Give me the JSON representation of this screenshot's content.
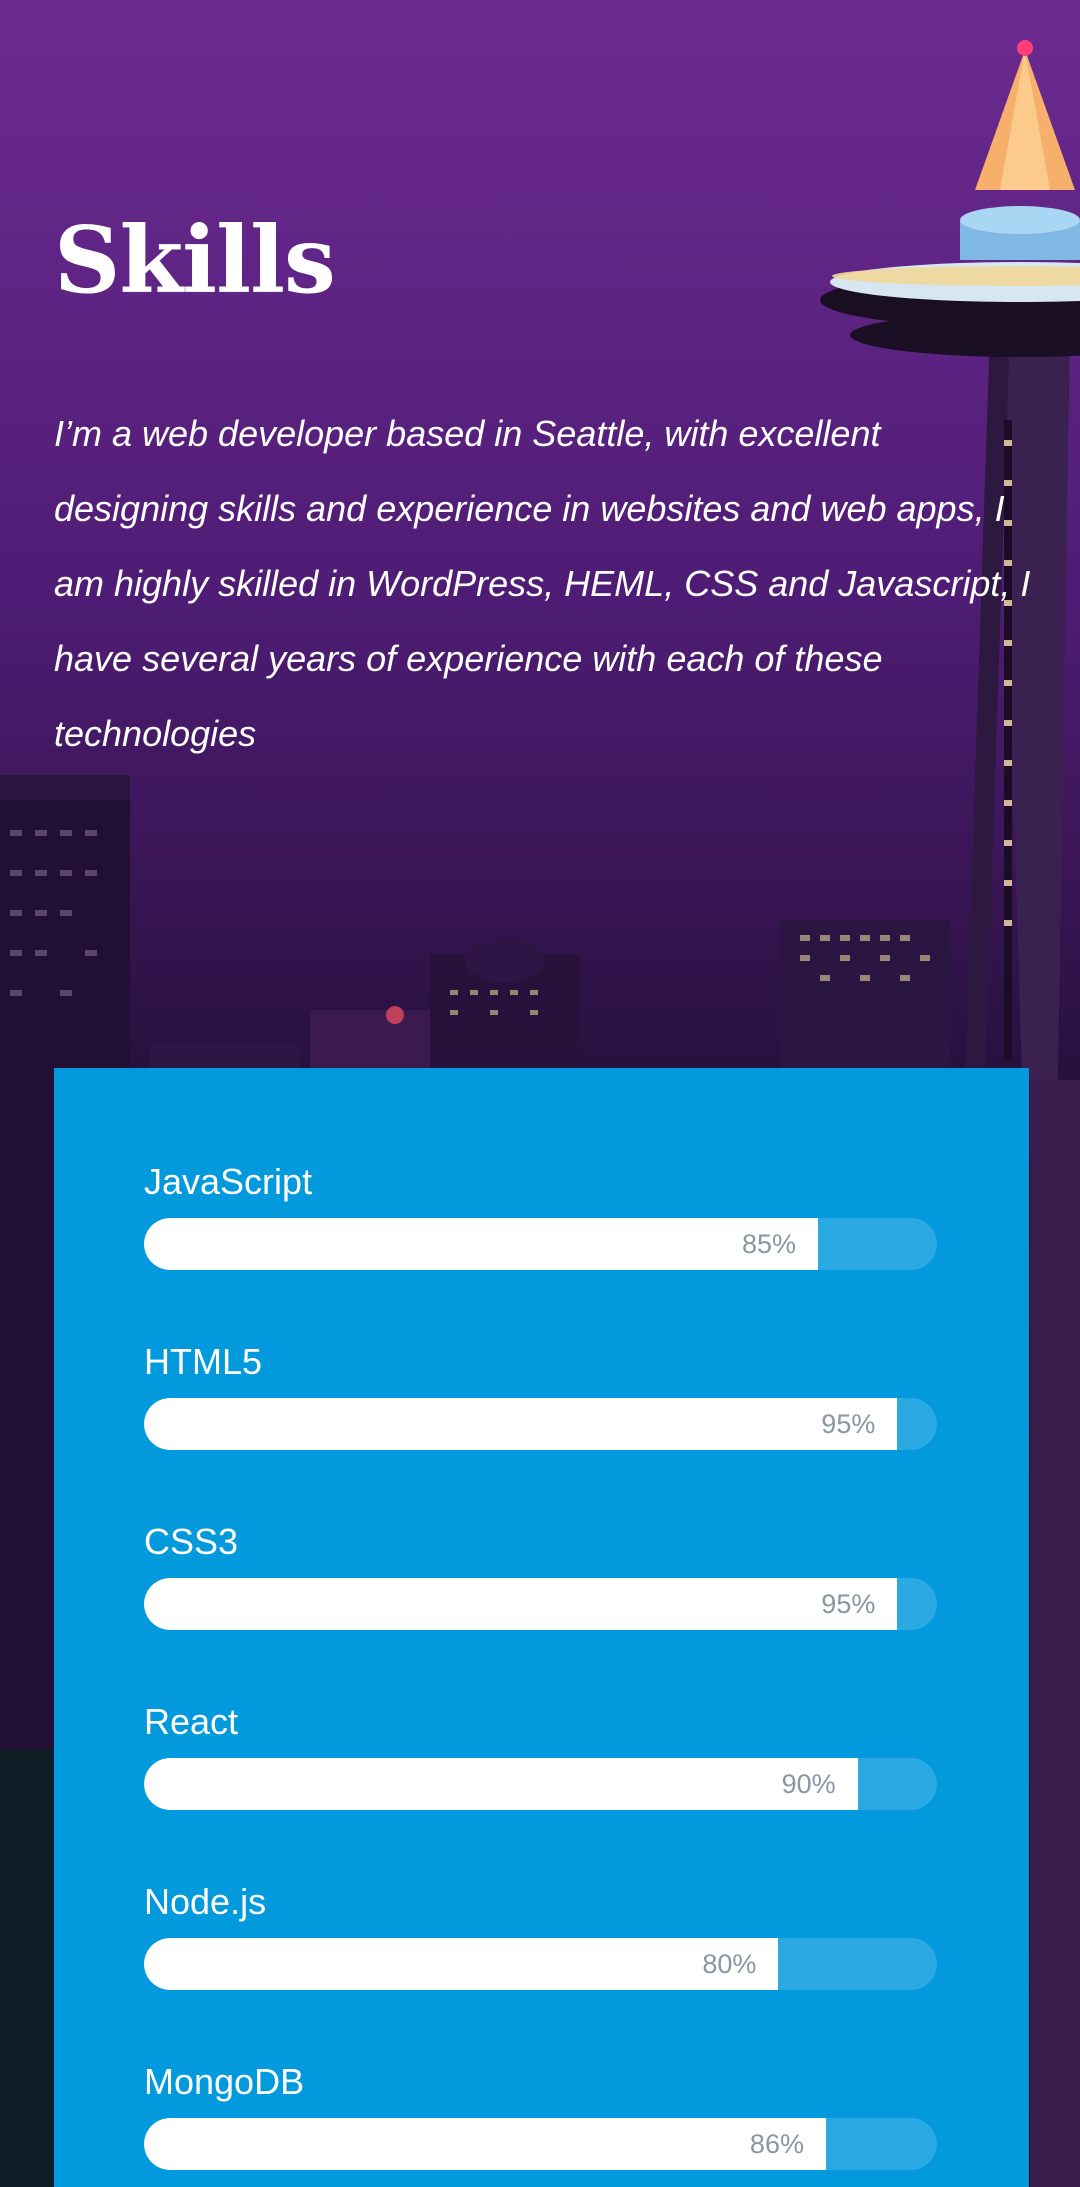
{
  "header": {
    "title": "Skills",
    "intro": "I’m a web developer based in Seattle, with excellent designing skills and experience in websites and web apps, I am highly skilled in WordPress, HEML, CSS and Javascript, I have several years of experience with each of these technologies"
  },
  "skills": [
    {
      "name": "JavaScript",
      "label": "85%",
      "value": 85
    },
    {
      "name": "HTML5",
      "label": "95%",
      "value": 95
    },
    {
      "name": "CSS3",
      "label": "95%",
      "value": 95
    },
    {
      "name": "React",
      "label": "90%",
      "value": 90
    },
    {
      "name": "Node.js",
      "label": "80%",
      "value": 80
    },
    {
      "name": "MongoDB",
      "label": "86%",
      "value": 86
    }
  ],
  "colors": {
    "card": "#0299dd",
    "bar_fill": "#ffffff",
    "bar_label": "#8a96a4",
    "sky_top": "#6b2a8f"
  }
}
